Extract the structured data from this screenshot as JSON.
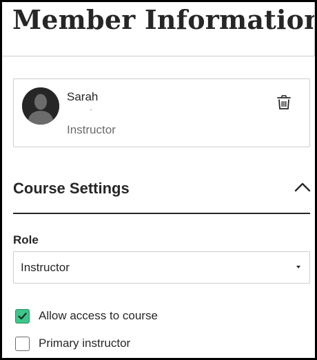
{
  "header": {
    "title": "Member Information"
  },
  "member": {
    "name": "Sarah",
    "role": "Instructor",
    "avatar_icon": "user-silhouette-icon",
    "delete_icon": "trash-icon"
  },
  "course_settings": {
    "title": "Course Settings",
    "collapse_icon": "chevron-up-icon",
    "role_label": "Role",
    "role_value": "Instructor",
    "role_dropdown_icon": "caret-down-icon",
    "options": [
      {
        "label": "Allow access to course",
        "checked": true
      },
      {
        "label": "Primary instructor",
        "checked": false
      }
    ]
  },
  "colors": {
    "text": "#262626",
    "muted": "#6a6a6a",
    "border": "#cdcdcd",
    "checkbox_checked": "#3ec58a"
  }
}
